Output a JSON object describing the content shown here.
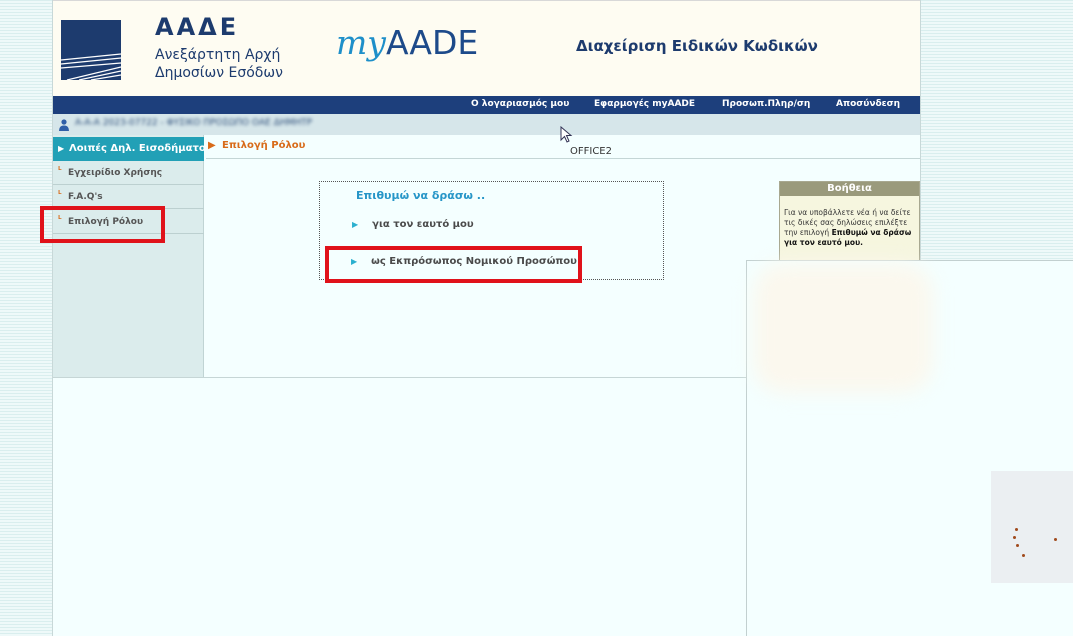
{
  "header": {
    "org_acronym": "ΑΑΔΕ",
    "org_name_line1": "Ανεξάρτητη Αρχή",
    "org_name_line2": "Δημοσίων Εσόδων",
    "app_logo_my": "my",
    "app_logo_aade": "AADE",
    "title": "Διαχείριση Ειδικών Κωδικών"
  },
  "topnav": {
    "items": [
      {
        "label": "Ο λογαριασμός μου"
      },
      {
        "label": "Εφαρμογές myAADE"
      },
      {
        "label": "Προσωπ.Πληρ/ση"
      },
      {
        "label": "Αποσύνδεση"
      }
    ]
  },
  "user": {
    "info": "Α-Α-Α 2023-07722 - ΦΥΣΙΚΟ ΠΡΟΣΩΠΟ ΟΑΕ ΔΗΜΗΤΡ"
  },
  "sidebar": {
    "active_label": "Λοιπές Δηλ. Εισοδήματος",
    "items": [
      {
        "label": "Εγχειρίδιο Χρήσης"
      },
      {
        "label": "F.A.Q's"
      },
      {
        "label": "Επιλογή Ρόλου"
      }
    ]
  },
  "breadcrumb": {
    "label": "Επιλογή Ρόλου"
  },
  "office_label": "OFFICE2",
  "role_choice": {
    "heading": "Επιθυμώ να δράσω ..",
    "options": [
      {
        "label": "για τον εαυτό μου"
      },
      {
        "label": "ως Εκπρόσωπος Νομικού Προσώπου"
      }
    ]
  },
  "help": {
    "title": "Βοήθεια",
    "text": "Για να υποβάλλετε νέα ή να δείτε τις δικές σας δηλώσεις επιλέξτε την επιλογή",
    "bold_text": "Επιθυμώ να δράσω για τον εαυτό μου."
  },
  "colors": {
    "nav_bg": "#1d3f7c",
    "active_sidebar": "#22a0b6",
    "accent_orange": "#d86b1a",
    "highlight_red": "#e0121a"
  }
}
